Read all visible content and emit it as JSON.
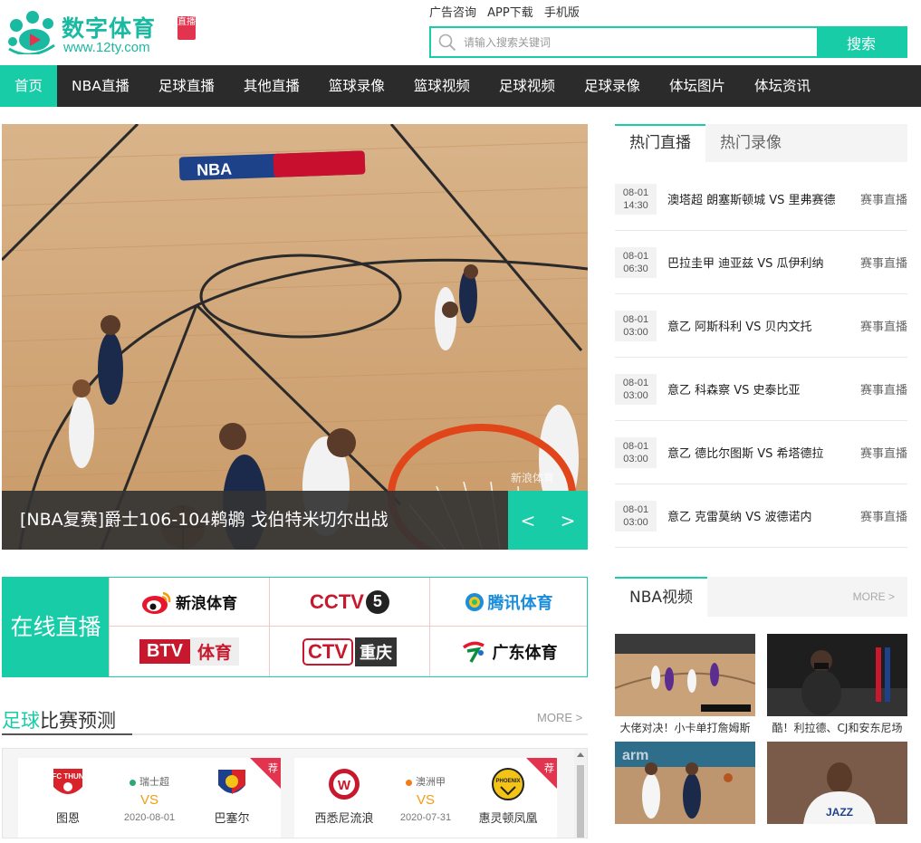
{
  "brand": {
    "title": "数字体育",
    "badge": "直播",
    "url": "www.12ty.com",
    "color": "#19b9a2"
  },
  "toplinks": [
    "广告咨询",
    "APP下载",
    "手机版"
  ],
  "search": {
    "placeholder": "请输入搜索关键词",
    "button": "搜索"
  },
  "nav": [
    "首页",
    "NBA直播",
    "足球直播",
    "其他直播",
    "篮球录像",
    "篮球视频",
    "足球视频",
    "足球录像",
    "体坛图片",
    "体坛资讯"
  ],
  "hero": {
    "caption": "[NBA复赛]爵士106-104鹈鹕 戈伯特米切尔出战",
    "prev": "<",
    "next": ">",
    "watermark": "新浪体育"
  },
  "online": {
    "label": "在线直播",
    "channels": {
      "sina": "新浪体育",
      "cctv": "CCTV",
      "cctv_num": "5",
      "tencent": "腾讯体育",
      "btv_a": "BTV",
      "btv_b": "体育",
      "ctv_a": "CTV",
      "ctv_b": "重庆",
      "gd": "广东体育"
    }
  },
  "prediction": {
    "title_hl": "足球",
    "title_rest": "比赛预测",
    "more": "MORE >",
    "tag": "荐",
    "matches": [
      {
        "home": "图恩",
        "home_logo": "FC THUN",
        "away": "巴塞尔",
        "league": "瑞士超",
        "league_color": "#2aa876",
        "vs": "VS",
        "date": "2020-08-01"
      },
      {
        "home": "西悉尼流浪",
        "home_logo": "W",
        "away": "惠灵顿凤凰",
        "away_logo": "PHOENIX",
        "league": "澳洲甲",
        "league_color": "#f07c1a",
        "vs": "VS",
        "date": "2020-07-31"
      }
    ]
  },
  "hot": {
    "tabs": [
      "热门直播",
      "热门录像"
    ],
    "rows": [
      {
        "date": "08-01",
        "time": "14:30",
        "match": "澳塔超 朗塞斯顿城 VS 里弗赛德",
        "link": "赛事直播"
      },
      {
        "date": "08-01",
        "time": "06:30",
        "match": "巴拉圭甲 迪亚兹 VS 瓜伊利纳",
        "link": "赛事直播"
      },
      {
        "date": "08-01",
        "time": "03:00",
        "match": "意乙 阿斯科利 VS 贝内文托",
        "link": "赛事直播"
      },
      {
        "date": "08-01",
        "time": "03:00",
        "match": "意乙 科森察 VS 史泰比亚",
        "link": "赛事直播"
      },
      {
        "date": "08-01",
        "time": "03:00",
        "match": "意乙 德比尔图斯 VS 希塔德拉",
        "link": "赛事直播"
      },
      {
        "date": "08-01",
        "time": "03:00",
        "match": "意乙 克雷莫纳 VS 波德诺内",
        "link": "赛事直播"
      }
    ]
  },
  "nba_video": {
    "title": "NBA视频",
    "more": "MORE >",
    "items": [
      {
        "caption": "大佬对决！小卡单打詹姆斯"
      },
      {
        "caption": "酷！利拉德、CJ和安东尼场"
      },
      {
        "caption": ""
      },
      {
        "caption": ""
      }
    ]
  },
  "colors": {
    "accent": "#19cca8",
    "nav_bg": "#2b2b2b",
    "red": "#c8182d"
  }
}
